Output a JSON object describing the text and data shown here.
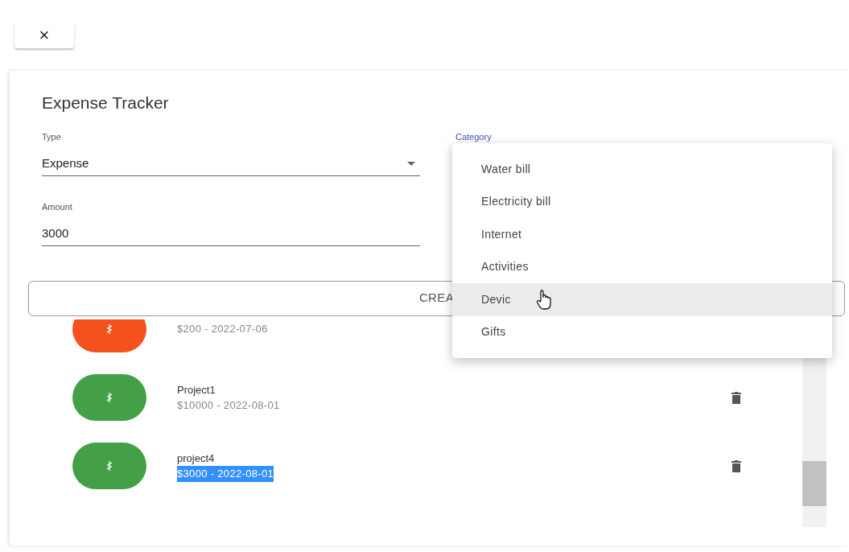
{
  "close_button": {
    "label": "×"
  },
  "form": {
    "title": "Expense Tracker",
    "type_field": {
      "label": "Type",
      "value": "Expense"
    },
    "category_field": {
      "label": "Category",
      "expanded": true
    },
    "amount_field": {
      "label": "Amount",
      "value": "3000"
    },
    "create_button": {
      "label": "CREA"
    }
  },
  "category_menu": [
    {
      "label": "Water bill",
      "highlighted": false
    },
    {
      "label": "Electricity bill",
      "highlighted": false
    },
    {
      "label": "Internet",
      "highlighted": false
    },
    {
      "label": "Activities",
      "highlighted": false
    },
    {
      "label": "Devic",
      "highlighted": true
    },
    {
      "label": "Gifts",
      "highlighted": false
    }
  ],
  "transactions": [
    {
      "secondary": "$200 - 2022-07-06",
      "color": "#f4511e",
      "text_selected": false
    },
    {
      "name": "Project1",
      "secondary": "$10000 - 2022-08-01",
      "color": "#43a047",
      "text_selected": false
    },
    {
      "name": "project4",
      "secondary": "$3000 - 2022-08-01",
      "color": "#43a047",
      "text_selected": true
    }
  ]
}
